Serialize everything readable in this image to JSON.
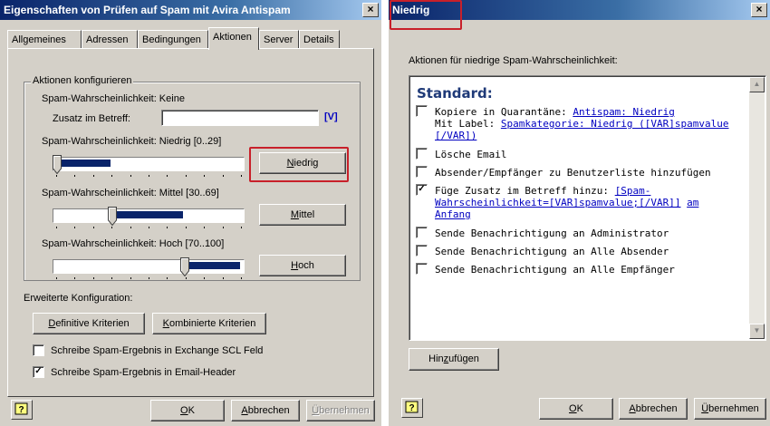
{
  "win1": {
    "title": "Eigenschaften von Prüfen auf Spam mit Avira Antispam",
    "close": "×",
    "tabs": [
      "Allgemeines",
      "Adressen",
      "Bedingungen",
      "Aktionen",
      "Server",
      "Details"
    ],
    "active_tab": "Aktionen",
    "group_title": "Aktionen konfigurieren",
    "spam_keine": "Spam-Wahrscheinlichkeit: Keine",
    "zusatz_label": "Zusatz im Betreff:",
    "zusatz_value": "",
    "var_button": "[V]",
    "niedrig_label": "Spam-Wahrscheinlichkeit: Niedrig [0..29]",
    "mittel_label": "Spam-Wahrscheinlichkeit: Mittel [30..69]",
    "hoch_label": "Spam-Wahrscheinlichkeit: Hoch [70..100]",
    "btn_niedrig": "Niedrig",
    "btn_mittel": "Mittel",
    "btn_hoch": "Hoch",
    "sliders": {
      "niedrig": {
        "min": 0,
        "max": 100,
        "from": 0,
        "to": 29
      },
      "mittel": {
        "min": 0,
        "max": 100,
        "from": 30,
        "to": 69
      },
      "hoch": {
        "min": 0,
        "max": 100,
        "from": 70,
        "to": 100
      }
    },
    "erweitert_label": "Erweiterte Konfiguration:",
    "btn_definitive": "Definitive Kriterien",
    "btn_kombinierte": "Kombinierte Kriterien",
    "chk_scl": {
      "label": "Schreibe Spam-Ergebnis in Exchange SCL Feld",
      "checked": false
    },
    "chk_header": {
      "label": "Schreibe Spam-Ergebnis in Email-Header",
      "checked": true
    },
    "btn_ok": "OK",
    "btn_abbrechen": "Abbrechen",
    "btn_uebernehmen": "Übernehmen"
  },
  "win2": {
    "title": "Niedrig",
    "close": "×",
    "heading": "Aktionen für niedrige Spam-Wahrscheinlichkeit:",
    "list_title": "Standard:",
    "items": [
      {
        "checked": false,
        "text1": "Kopiere in Quarantäne: ",
        "link1": "Antispam: Niedrig",
        "text2": "Mit Label: ",
        "link2": "Spamkategorie: Niedrig ([VAR]spamvalue",
        "link3": "[/VAR])"
      },
      {
        "checked": false,
        "text": "Lösche Email"
      },
      {
        "checked": false,
        "text": "Absender/Empfänger zu Benutzerliste hinzufügen"
      },
      {
        "checked": true,
        "text1": "Füge Zusatz im Betreff hinzu: ",
        "link1": "[Spam-",
        "link2": "Wahrscheinlichkeit=[VAR]spamvalue;[/VAR]]",
        "link3": "am",
        "link4": "Anfang"
      },
      {
        "checked": false,
        "text": "Sende Benachrichtigung an Administrator"
      },
      {
        "checked": false,
        "text": "Sende Benachrichtigung an Alle Absender"
      },
      {
        "checked": false,
        "text": "Sende Benachrichtigung an Alle Empfänger"
      }
    ],
    "check_mark": "✓",
    "btn_hinzufuegen": "Hinzufügen",
    "btn_ok": "OK",
    "btn_abbrechen": "Abbrechen",
    "btn_uebernehmen": "Übernehmen"
  }
}
